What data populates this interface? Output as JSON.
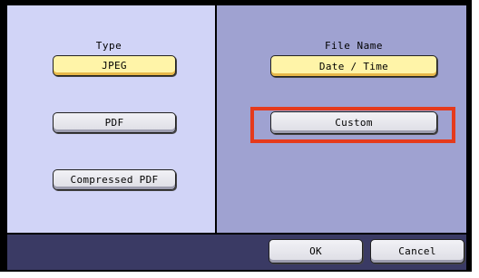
{
  "type_section": {
    "label": "Type",
    "options": [
      {
        "label": "JPEG",
        "selected": true
      },
      {
        "label": "PDF",
        "selected": false
      },
      {
        "label": "Compressed PDF",
        "selected": false
      }
    ]
  },
  "filename_section": {
    "label": "File Name",
    "options": [
      {
        "label": "Date / Time",
        "selected": true
      },
      {
        "label": "Custom",
        "selected": false
      }
    ]
  },
  "footer": {
    "ok_label": "OK",
    "cancel_label": "Cancel"
  },
  "colors": {
    "left_panel": "#d1d4f7",
    "right_panel": "#9fa2d1",
    "bottom_bar": "#3a3a64",
    "selected_button": "#fff4a8",
    "highlight": "#e53a1c"
  }
}
